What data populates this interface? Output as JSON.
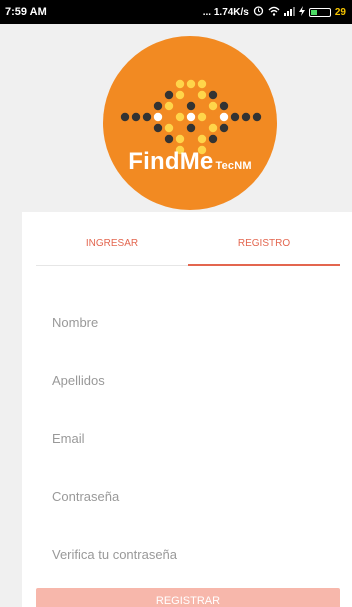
{
  "status_bar": {
    "time": "7:59 AM",
    "network_speed": "... 1.74K/s",
    "battery_pct": "29",
    "icons": [
      "alarm-icon",
      "wifi-icon",
      "signal-icon",
      "charging-icon",
      "battery-icon"
    ]
  },
  "logo": {
    "title": "FindMe",
    "subtitle": "TecNM",
    "brand_color": "#f28a22"
  },
  "tabs": [
    {
      "label": "INGRESAR",
      "active": false
    },
    {
      "label": "REGISTRO",
      "active": true
    }
  ],
  "form": {
    "nombre_placeholder": "Nombre",
    "apellidos_placeholder": "Apellidos",
    "email_placeholder": "Email",
    "password_placeholder": "Contraseña",
    "confirm_placeholder": "Verifica tu contraseña",
    "submit_label": "REGISTRAR"
  },
  "colors": {
    "accent": "#e3664f",
    "button_disabled": "#f7b7ab"
  }
}
